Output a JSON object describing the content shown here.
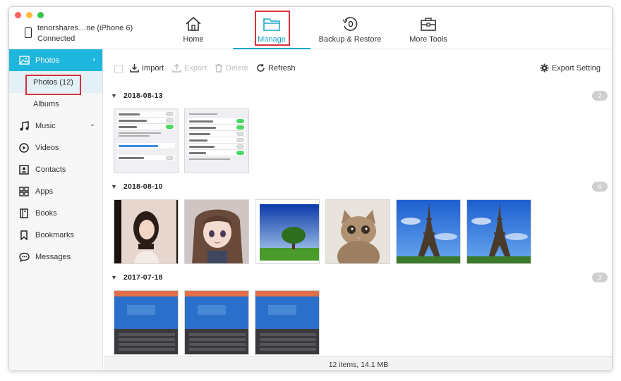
{
  "device": {
    "name": "tenorshares…ne (iPhone 6)",
    "status": "Connected"
  },
  "nav": {
    "home": "Home",
    "manage": "Manage",
    "backup": "Backup & Restore",
    "tools": "More Tools"
  },
  "sidebar": {
    "photos": "Photos",
    "photos_sub": "Photos (12)",
    "albums": "Albums",
    "music": "Music",
    "videos": "Videos",
    "contacts": "Contacts",
    "apps": "Apps",
    "books": "Books",
    "bookmarks": "Bookmarks",
    "messages": "Messages"
  },
  "toolbar": {
    "import": "Import",
    "export": "Export",
    "delete": "Delete",
    "refresh": "Refresh",
    "export_setting": "Export Setting"
  },
  "groups": [
    {
      "date": "2018-08-13",
      "count": "2"
    },
    {
      "date": "2018-08-10",
      "count": "6"
    },
    {
      "date": "2017-07-18",
      "count": "3"
    }
  ],
  "status": "12 items, 14.1 MB",
  "colors": {
    "accent": "#1eb6dc",
    "highlight_box": "#d9303d"
  }
}
